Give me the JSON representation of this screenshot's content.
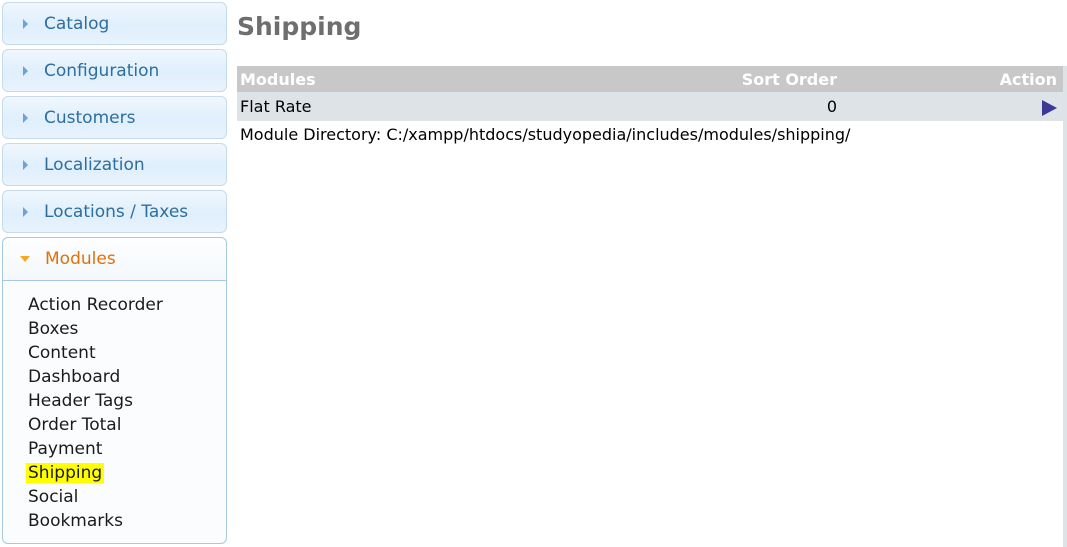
{
  "sidebar": {
    "sections": [
      {
        "label": "Catalog"
      },
      {
        "label": "Configuration"
      },
      {
        "label": "Customers"
      },
      {
        "label": "Localization"
      },
      {
        "label": "Locations / Taxes"
      }
    ],
    "active_section": {
      "label": "Modules",
      "items": [
        {
          "label": "Action Recorder"
        },
        {
          "label": "Boxes"
        },
        {
          "label": "Content"
        },
        {
          "label": "Dashboard"
        },
        {
          "label": "Header Tags"
        },
        {
          "label": "Order Total"
        },
        {
          "label": "Payment"
        },
        {
          "label": "Shipping",
          "highlighted": true
        },
        {
          "label": "Social"
        },
        {
          "label": "Bookmarks"
        }
      ]
    }
  },
  "page": {
    "title": "Shipping",
    "table": {
      "headers": [
        "Modules",
        "Sort Order",
        "Action"
      ],
      "rows": [
        {
          "module": "Flat Rate",
          "sort_order": "0",
          "action_icon": "play-arrow-icon"
        }
      ]
    },
    "module_directory": "Module Directory: C:/xampp/htdocs/studyopedia/includes/modules/shipping/"
  },
  "colors": {
    "highlight": "#ffff00",
    "active_section": "#e17009",
    "section_text": "#2e6e9e",
    "action_icon": "#3c3895"
  }
}
